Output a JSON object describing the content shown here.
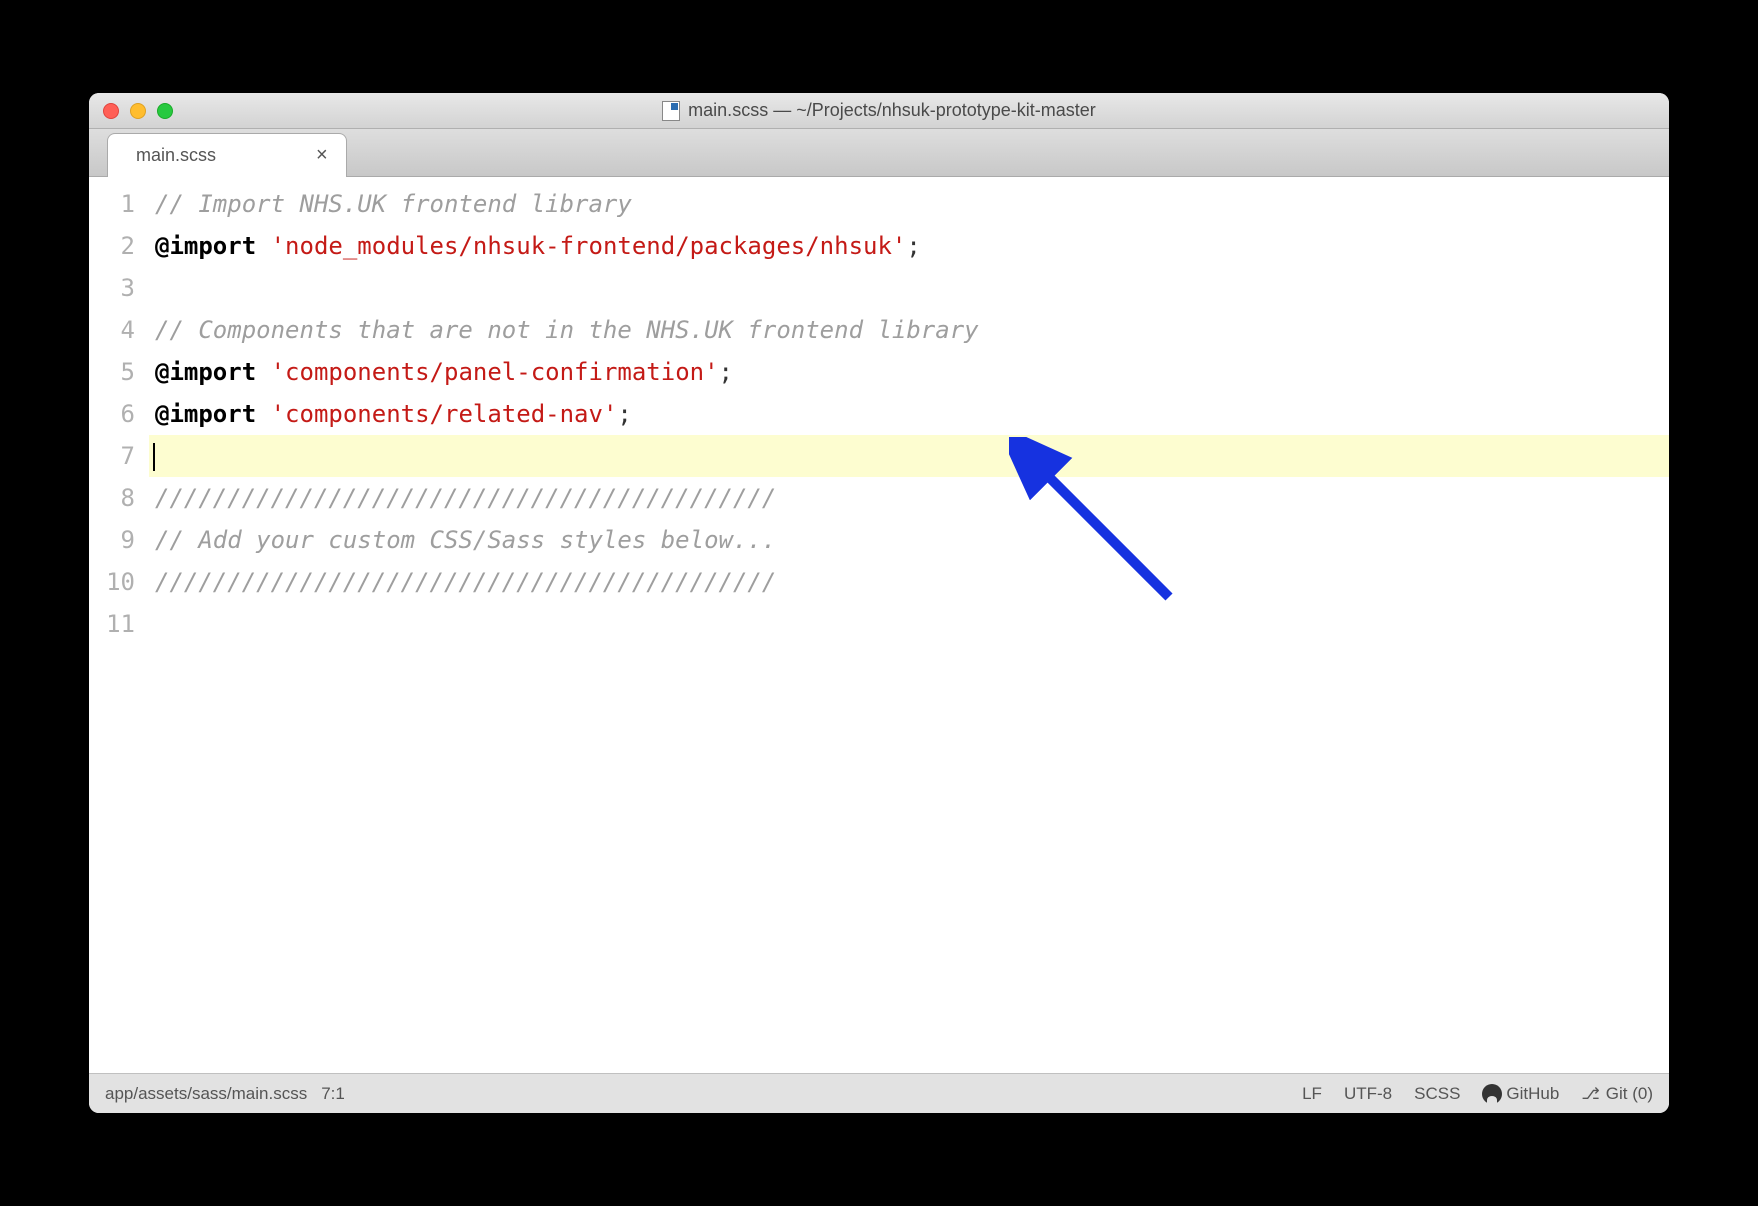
{
  "window": {
    "title": "main.scss — ~/Projects/nhsuk-prototype-kit-master"
  },
  "tab": {
    "name": "main.scss"
  },
  "lines": [
    {
      "num": "1",
      "segments": [
        {
          "cls": "comment",
          "text": "// Import NHS.UK frontend library"
        }
      ]
    },
    {
      "num": "2",
      "segments": [
        {
          "cls": "keyword",
          "text": "@import"
        },
        {
          "cls": "punct",
          "text": " "
        },
        {
          "cls": "string",
          "text": "'node_modules/nhsuk-frontend/packages/nhsuk'"
        },
        {
          "cls": "punct",
          "text": ";"
        }
      ]
    },
    {
      "num": "3",
      "segments": []
    },
    {
      "num": "4",
      "segments": [
        {
          "cls": "comment",
          "text": "// Components that are not in the NHS.UK frontend library"
        }
      ]
    },
    {
      "num": "5",
      "segments": [
        {
          "cls": "keyword",
          "text": "@import"
        },
        {
          "cls": "punct",
          "text": " "
        },
        {
          "cls": "string",
          "text": "'components/panel-confirmation'"
        },
        {
          "cls": "punct",
          "text": ";"
        }
      ]
    },
    {
      "num": "6",
      "segments": [
        {
          "cls": "keyword",
          "text": "@import"
        },
        {
          "cls": "punct",
          "text": " "
        },
        {
          "cls": "string",
          "text": "'components/related-nav'"
        },
        {
          "cls": "punct",
          "text": ";"
        }
      ]
    },
    {
      "num": "7",
      "highlight": true,
      "cursor": true,
      "segments": []
    },
    {
      "num": "8",
      "segments": [
        {
          "cls": "comment",
          "text": "///////////////////////////////////////////"
        }
      ]
    },
    {
      "num": "9",
      "segments": [
        {
          "cls": "comment",
          "text": "// Add your custom CSS/Sass styles below..."
        }
      ]
    },
    {
      "num": "10",
      "segments": [
        {
          "cls": "comment",
          "text": "///////////////////////////////////////////"
        }
      ]
    },
    {
      "num": "11",
      "segments": []
    }
  ],
  "status": {
    "path": "app/assets/sass/main.scss",
    "position": "7:1",
    "line_ending": "LF",
    "encoding": "UTF-8",
    "grammar": "SCSS",
    "github": "GitHub",
    "git": "Git (0)"
  }
}
